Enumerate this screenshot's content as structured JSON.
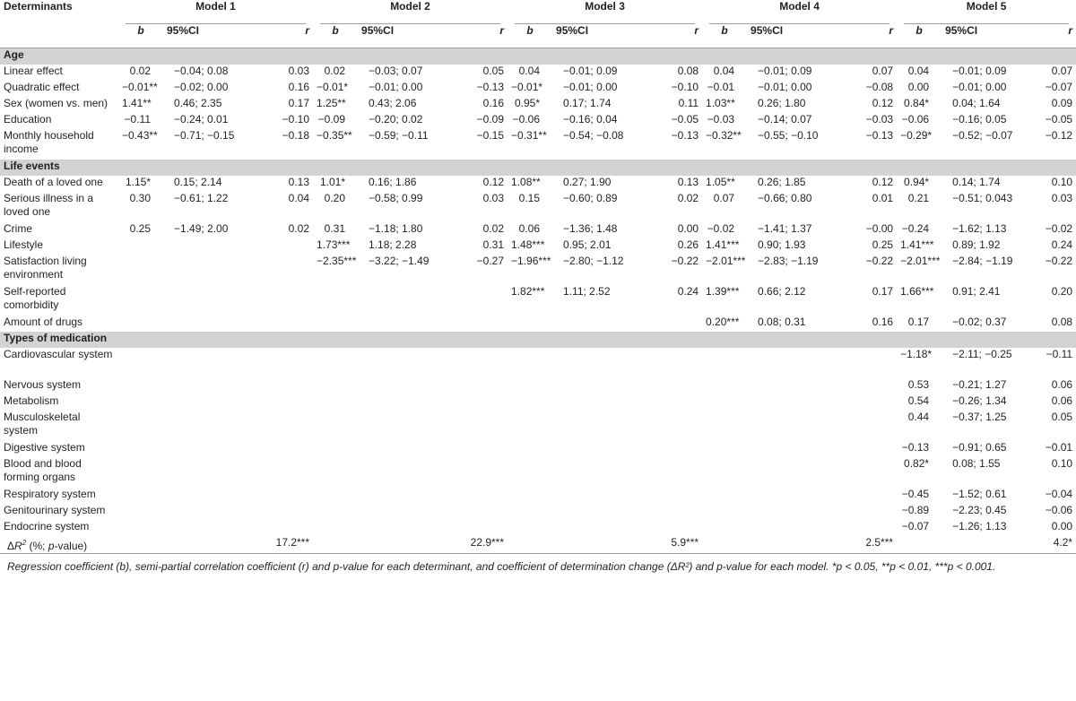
{
  "header": {
    "determinants": "Determinants",
    "models": [
      "Model 1",
      "Model 2",
      "Model 3",
      "Model 4",
      "Model 5"
    ],
    "sub": {
      "b": "b",
      "ci": "95%CI",
      "r": "r"
    }
  },
  "sections": [
    {
      "title": "Age",
      "rows": [
        {
          "label": "Linear effect",
          "cells": [
            [
              "0.02",
              "−0.04; 0.08",
              "0.03"
            ],
            [
              "0.02",
              "−0.03; 0.07",
              "0.05"
            ],
            [
              "0.04",
              "−0.01; 0.09",
              "0.08"
            ],
            [
              "0.04",
              "−0.01; 0.09",
              "0.07"
            ],
            [
              "0.04",
              "−0.01; 0.09",
              "0.07"
            ]
          ]
        },
        {
          "label": "Quadratic effect",
          "cells": [
            [
              "−0.01**",
              "−0.02; 0.00",
              "0.16"
            ],
            [
              "−0.01*",
              "−0.01; 0.00",
              "−0.13"
            ],
            [
              "−0.01*",
              "−0.01; 0.00",
              "−0.10"
            ],
            [
              "−0.01",
              "−0.01; 0.00",
              "−0.08"
            ],
            [
              "0.00",
              "−0.01; 0.00",
              "−0.07"
            ]
          ]
        },
        {
          "label": "Sex (women vs. men)",
          "cells": [
            [
              "1.41**",
              "0.46; 2.35",
              "0.17"
            ],
            [
              "1.25**",
              "0.43; 2.06",
              "0.16"
            ],
            [
              "0.95*",
              "0.17; 1.74",
              "0.11"
            ],
            [
              "1.03**",
              "0.26; 1.80",
              "0.12"
            ],
            [
              "0.84*",
              "0.04; 1.64",
              "0.09"
            ]
          ]
        },
        {
          "label": "Education",
          "cells": [
            [
              "−0.11",
              "−0.24; 0.01",
              "−0.10"
            ],
            [
              "−0.09",
              "−0.20; 0.02",
              "−0.09"
            ],
            [
              "−0.06",
              "−0.16; 0.04",
              "−0.05"
            ],
            [
              "−0.03",
              "−0.14; 0.07",
              "−0.03"
            ],
            [
              "−0.06",
              "−0.16; 0.05",
              "−0.05"
            ]
          ]
        },
        {
          "label": "Monthly household income",
          "tall": true,
          "cells": [
            [
              "−0.43**",
              "−0.71; −0.15",
              "−0.18"
            ],
            [
              "−0.35**",
              "−0.59; −0.11",
              "−0.15"
            ],
            [
              "−0.31**",
              "−0.54; −0.08",
              "−0.13"
            ],
            [
              "−0.32**",
              "−0.55; −0.10",
              "−0.13"
            ],
            [
              "−0.29*",
              "−0.52; −0.07",
              "−0.12"
            ]
          ]
        }
      ]
    },
    {
      "title": "Life events",
      "rows": [
        {
          "label": "Death of a loved one",
          "cells": [
            [
              "1.15*",
              "0.15; 2.14",
              "0.13"
            ],
            [
              "1.01*",
              "0.16; 1.86",
              "0.12"
            ],
            [
              "1.08**",
              "0.27; 1.90",
              "0.13"
            ],
            [
              "1.05**",
              "0.26; 1.85",
              "0.12"
            ],
            [
              "0.94*",
              "0.14; 1.74",
              "0.10"
            ]
          ]
        },
        {
          "label": "Serious illness in a loved one",
          "tall": true,
          "cells": [
            [
              "0.30",
              "−0.61; 1.22",
              "0.04"
            ],
            [
              "0.20",
              "−0.58; 0.99",
              "0.03"
            ],
            [
              "0.15",
              "−0.60; 0.89",
              "0.02"
            ],
            [
              "0.07",
              "−0.66; 0.80",
              "0.01"
            ],
            [
              "0.21",
              "−0.51; 0.043",
              "0.03"
            ]
          ]
        },
        {
          "label": "Crime",
          "cells": [
            [
              "0.25",
              "−1.49; 2.00",
              "0.02"
            ],
            [
              "0.31",
              "−1.18; 1.80",
              "0.02"
            ],
            [
              "0.06",
              "−1.36; 1.48",
              "0.00"
            ],
            [
              "−0.02",
              "−1.41; 1.37",
              "−0.00"
            ],
            [
              "−0.24",
              "−1.62; 1.13",
              "−0.02"
            ]
          ]
        },
        {
          "label": "Lifestyle",
          "cells": [
            [
              "",
              "",
              ""
            ],
            [
              "1.73***",
              "1.18; 2.28",
              "0.31"
            ],
            [
              "1.48***",
              "0.95; 2.01",
              "0.26"
            ],
            [
              "1.41***",
              "0.90; 1.93",
              "0.25"
            ],
            [
              "1.41***",
              "0.89; 1.92",
              "0.24"
            ]
          ]
        },
        {
          "label": "Satisfaction living environment",
          "tall": true,
          "cells": [
            [
              "",
              "",
              ""
            ],
            [
              "−2.35***",
              "−3.22; −1.49",
              "−0.27"
            ],
            [
              "−1.96***",
              "−2.80; −1.12",
              "−0.22"
            ],
            [
              "−2.01***",
              "−2.83; −1.19",
              "−0.22"
            ],
            [
              "−2.01***",
              "−2.84; −1.19",
              "−0.22"
            ]
          ]
        },
        {
          "label": "Self-reported comorbidity",
          "tall": true,
          "cells": [
            [
              "",
              "",
              ""
            ],
            [
              "",
              "",
              ""
            ],
            [
              "1.82***",
              "1.11; 2.52",
              "0.24"
            ],
            [
              "1.39***",
              "0.66; 2.12",
              "0.17"
            ],
            [
              "1.66***",
              "0.91; 2.41",
              "0.20"
            ]
          ]
        },
        {
          "label": "Amount of drugs",
          "cells": [
            [
              "",
              "",
              ""
            ],
            [
              "",
              "",
              ""
            ],
            [
              "",
              "",
              ""
            ],
            [
              "0.20***",
              "0.08; 0.31",
              "0.16"
            ],
            [
              "0.17",
              "−0.02; 0.37",
              "0.08"
            ]
          ]
        }
      ]
    },
    {
      "title": "Types of medication",
      "rows": [
        {
          "label": "Cardiovascular system",
          "tall": true,
          "cells": [
            [
              "",
              "",
              ""
            ],
            [
              "",
              "",
              ""
            ],
            [
              "",
              "",
              ""
            ],
            [
              "",
              "",
              ""
            ],
            [
              "−1.18*",
              "−2.11; −0.25",
              "−0.11"
            ]
          ]
        },
        {
          "label": "Nervous system",
          "cells": [
            [
              "",
              "",
              ""
            ],
            [
              "",
              "",
              ""
            ],
            [
              "",
              "",
              ""
            ],
            [
              "",
              "",
              ""
            ],
            [
              "0.53",
              "−0.21; 1.27",
              "0.06"
            ]
          ]
        },
        {
          "label": "Metabolism",
          "cells": [
            [
              "",
              "",
              ""
            ],
            [
              "",
              "",
              ""
            ],
            [
              "",
              "",
              ""
            ],
            [
              "",
              "",
              ""
            ],
            [
              "0.54",
              "−0.26; 1.34",
              "0.06"
            ]
          ]
        },
        {
          "label": "Musculoskeletal system",
          "tall": true,
          "cells": [
            [
              "",
              "",
              ""
            ],
            [
              "",
              "",
              ""
            ],
            [
              "",
              "",
              ""
            ],
            [
              "",
              "",
              ""
            ],
            [
              "0.44",
              "−0.37; 1.25",
              "0.05"
            ]
          ]
        },
        {
          "label": "Digestive system",
          "cells": [
            [
              "",
              "",
              ""
            ],
            [
              "",
              "",
              ""
            ],
            [
              "",
              "",
              ""
            ],
            [
              "",
              "",
              ""
            ],
            [
              "−0.13",
              "−0.91; 0.65",
              "−0.01"
            ]
          ]
        },
        {
          "label": "Blood and blood forming organs",
          "tall": true,
          "cells": [
            [
              "",
              "",
              ""
            ],
            [
              "",
              "",
              ""
            ],
            [
              "",
              "",
              ""
            ],
            [
              "",
              "",
              ""
            ],
            [
              "0.82*",
              "0.08; 1.55",
              "0.10"
            ]
          ]
        },
        {
          "label": "Respiratory system",
          "cells": [
            [
              "",
              "",
              ""
            ],
            [
              "",
              "",
              ""
            ],
            [
              "",
              "",
              ""
            ],
            [
              "",
              "",
              ""
            ],
            [
              "−0.45",
              "−1.52; 0.61",
              "−0.04"
            ]
          ]
        },
        {
          "label": "Genitourinary system",
          "cells": [
            [
              "",
              "",
              ""
            ],
            [
              "",
              "",
              ""
            ],
            [
              "",
              "",
              ""
            ],
            [
              "",
              "",
              ""
            ],
            [
              "−0.89",
              "−2.23; 0.45",
              "−0.06"
            ]
          ]
        },
        {
          "label": "Endocrine system",
          "cells": [
            [
              "",
              "",
              ""
            ],
            [
              "",
              "",
              ""
            ],
            [
              "",
              "",
              ""
            ],
            [
              "",
              "",
              ""
            ],
            [
              "−0.07",
              "−1.26; 1.13",
              "0.00"
            ]
          ]
        }
      ]
    }
  ],
  "final_row": {
    "label_prefix": "Δ",
    "label_R": "R",
    "label_sup": "2",
    "label_suffix": " (%; ",
    "label_p": "p",
    "label_end": "-value)",
    "values": [
      "17.2***",
      "22.9***",
      "5.9***",
      "2.5***",
      "4.2*"
    ]
  },
  "footnote": "Regression coefficient (b), semi-partial correlation coefficient (r) and p-value for each determinant, and coefficient of determination change (ΔR²) and p-value for each model. *p < 0.05, **p < 0.01, ***p < 0.001."
}
